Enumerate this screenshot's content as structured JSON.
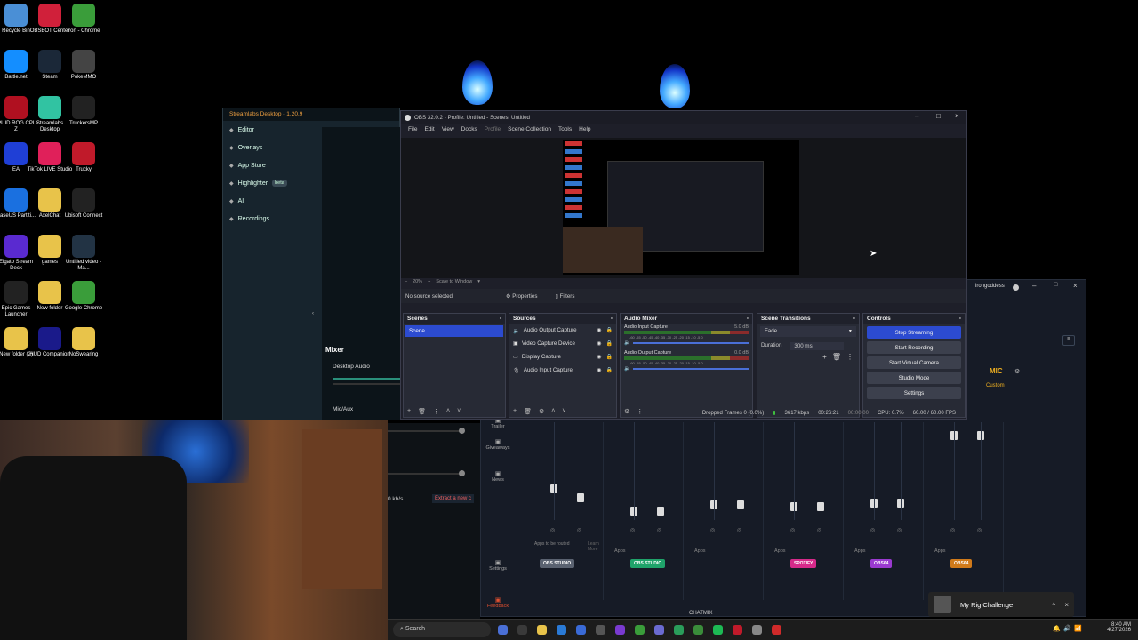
{
  "desktop": {
    "icons": [
      {
        "label": "Recycle Bin",
        "name": "recycle-bin-icon",
        "color": "#4a8fd6"
      },
      {
        "label": "OBSBOT Center",
        "name": "obsbot-icon",
        "color": "#d0203a"
      },
      {
        "label": "Iron - Chrome",
        "name": "iron-chrome-icon",
        "color": "#3a9d3a"
      },
      {
        "label": "Battle.net",
        "name": "battlenet-icon",
        "color": "#148eff"
      },
      {
        "label": "Steam",
        "name": "steam-icon",
        "color": "#1b2838"
      },
      {
        "label": "PokeMMO",
        "name": "pokemmo-icon",
        "color": "#444"
      },
      {
        "label": "CPUID ROG CPU-Z",
        "name": "cpuz-icon",
        "color": "#b01020"
      },
      {
        "label": "Streamlabs Desktop",
        "name": "streamlabs-icon",
        "color": "#31c3a2"
      },
      {
        "label": "TruckersMP",
        "name": "truckersmp-icon",
        "color": "#222"
      },
      {
        "label": "EA",
        "name": "ea-icon",
        "color": "#1f3fd6"
      },
      {
        "label": "TikTok LIVE Studio",
        "name": "tiktok-icon",
        "color": "#e0205a"
      },
      {
        "label": "Trucky",
        "name": "trucky-icon",
        "color": "#c01a2a"
      },
      {
        "label": "EaseUS Partiti...",
        "name": "easeus-icon",
        "color": "#1a70e0"
      },
      {
        "label": "AxelChat",
        "name": "folder-icon",
        "color": "#e8c34a"
      },
      {
        "label": "Ubisoft Connect",
        "name": "ubisoft-icon",
        "color": "#222"
      },
      {
        "label": "Elgato Stream Deck",
        "name": "elgato-icon",
        "color": "#5a2ad0"
      },
      {
        "label": "games",
        "name": "folder-icon",
        "color": "#e8c34a"
      },
      {
        "label": "Untitled video - Ma...",
        "name": "video-icon",
        "color": "#234"
      },
      {
        "label": "Epic Games Launcher",
        "name": "epic-icon",
        "color": "#222"
      },
      {
        "label": "New folder",
        "name": "folder-icon",
        "color": "#e8c34a"
      },
      {
        "label": "Google Chrome",
        "name": "chrome-icon",
        "color": "#3a9d3a"
      },
      {
        "label": "New folder (2)",
        "name": "folder-icon",
        "color": "#e8c34a"
      },
      {
        "label": "HUD Companion",
        "name": "hud-icon",
        "color": "#1a1a8a"
      },
      {
        "label": "NoSwearing",
        "name": "folder-icon",
        "color": "#e8c34a"
      }
    ]
  },
  "streamlabs": {
    "title": "Streamlabs Desktop - 1.20.9",
    "items": [
      {
        "label": "Editor",
        "arrow": "⌄"
      },
      {
        "label": "Overlays",
        "arrow": "⌄"
      },
      {
        "label": "App Store",
        "arrow": "⌄"
      },
      {
        "label": "Highlighter",
        "badge": "beta"
      },
      {
        "label": "AI"
      },
      {
        "label": "Recordings"
      }
    ],
    "mixer_title": "Mixer",
    "desktop_audio": "Desktop Audio",
    "mic_aux": "Mic/Aux",
    "kbs": "0 kb/s",
    "extract": "Extract a new c"
  },
  "obs": {
    "title": "OBS 32.0.2 - Profile: Untitled - Scenes: Untitled",
    "menu": [
      "File",
      "Edit",
      "View",
      "Docks",
      "Profile",
      "Scene Collection",
      "Tools",
      "Help"
    ],
    "zoom": "20%",
    "scale": "Scale to Window",
    "no_source": "No source selected",
    "properties": "Properties",
    "filters": "Filters",
    "docks": {
      "scenes": {
        "title": "Scenes",
        "items": [
          "Scene"
        ]
      },
      "sources": {
        "title": "Sources",
        "items": [
          "Audio Output Capture",
          "Video Capture Device",
          "Display Capture",
          "Audio Input Capture"
        ]
      },
      "mixer": {
        "title": "Audio Mixer",
        "channels": [
          {
            "name": "Audio Input Capture",
            "db": "5.0 dB"
          },
          {
            "name": "Audio Output Capture",
            "db": "0.0 dB"
          }
        ],
        "scale": "-60 -55 -50 -45 -40 -35 -30 -25 -20 -15 -10 -5 0"
      },
      "transitions": {
        "title": "Scene Transitions",
        "type": "Fade",
        "duration_label": "Duration",
        "duration": "300 ms"
      },
      "controls": {
        "title": "Controls",
        "buttons": [
          "Stop Streaming",
          "Start Recording",
          "Start Virtual Camera",
          "Studio Mode",
          "Settings"
        ]
      }
    },
    "status": {
      "dropped": "Dropped Frames 0 (0.0%)",
      "kbps": "3617 kbps",
      "live": "00:26:21",
      "rec": "00:00:00",
      "cpu": "CPU: 0.7%",
      "fps": "60.00 / 60.00 FPS"
    }
  },
  "mixerapp": {
    "user": "irongoddess",
    "mic": "MIC",
    "custom": "Custom",
    "side": [
      "Trailer",
      "Giveaways",
      "News",
      "Settings",
      "Feedback"
    ],
    "apps_to_route": "Apps to be routed",
    "learn_more": "Learn More",
    "apps": "Apps",
    "tags": [
      {
        "label": "OBS STUDIO",
        "color": "#5a6270"
      },
      {
        "label": "OBS STUDIO",
        "color": "#1fa36a"
      },
      {
        "label": "SPOTIFY",
        "color": "#d62a8a"
      },
      {
        "label": "OBS64",
        "color": "#9a3ad0"
      },
      {
        "label": "OBS64",
        "color": "#d07a1a"
      }
    ],
    "chatmix": "CHATMIX"
  },
  "notification": {
    "title": "My Rig Challenge"
  },
  "taskbar": {
    "search": "Search",
    "time": "8:40 AM",
    "date": "4/27/2026"
  }
}
